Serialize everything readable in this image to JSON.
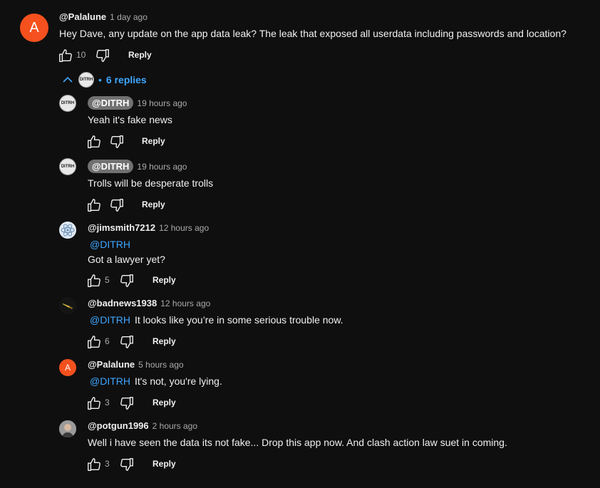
{
  "top_comment": {
    "avatar_letter": "A",
    "handle": "@Palalune",
    "time": "1 day ago",
    "text": "Hey Dave, any update on the app data leak? The leak that exposed all userdata including passwords and location?",
    "likes": "10",
    "reply_label": "Reply"
  },
  "replies_toggle": {
    "label": "6 replies",
    "avatar_text": "DITRH"
  },
  "replies": [
    {
      "handle": "@DITRH",
      "time": "19 hours ago",
      "text": "Yeah it's fake news",
      "reply_label": "Reply",
      "avatar_text": "DITRH"
    },
    {
      "handle": "@DITRH",
      "time": "19 hours ago",
      "text": "Trolls will be desperate trolls",
      "reply_label": "Reply",
      "avatar_text": "DITRH"
    },
    {
      "handle": "@jimsmith7212",
      "time": "12 hours ago",
      "mention": "@DITRH",
      "text": "Got a lawyer yet?",
      "likes": "5",
      "reply_label": "Reply"
    },
    {
      "handle": "@badnews1938",
      "time": "12 hours ago",
      "mention": "@DITRH",
      "text": "It looks like you’re in some serious trouble now.",
      "likes": "6",
      "reply_label": "Reply"
    },
    {
      "handle": "@Palalune",
      "time": "5 hours ago",
      "avatar_letter": "A",
      "mention": "@DITRH",
      "text": "It's not, you're lying.",
      "likes": "3",
      "reply_label": "Reply"
    },
    {
      "handle": "@potgun1996",
      "time": "2 hours ago",
      "text": "Well i have seen the data its not fake... Drop this app now. And clash action law suet in coming.",
      "likes": "3",
      "reply_label": "Reply"
    }
  ],
  "colors": {
    "background": "#0f0f0f",
    "accent_link": "#3ea6ff",
    "avatar_orange": "#f4511e",
    "owner_pill": "#717171"
  }
}
